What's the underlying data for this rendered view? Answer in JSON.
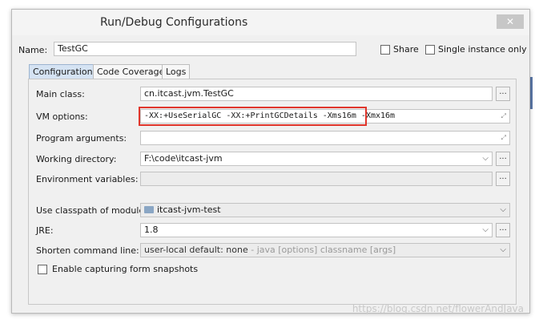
{
  "window": {
    "title": "Run/Debug Configurations",
    "close_glyph": "✕"
  },
  "name_row": {
    "label": "Name:",
    "value": "TestGC",
    "share_label": "Share",
    "single_instance_label": "Single instance only"
  },
  "tabs": [
    {
      "label": "Configuration",
      "active": true
    },
    {
      "label": "Code Coverage",
      "active": false
    },
    {
      "label": "Logs",
      "active": false
    }
  ],
  "form": {
    "main_class": {
      "label": "Main class:",
      "value": "cn.itcast.jvm.TestGC"
    },
    "vm_options": {
      "label": "VM options:",
      "value": "-XX:+UseSerialGC -XX:+PrintGCDetails -Xms16m -Xmx16m"
    },
    "program_arguments": {
      "label": "Program arguments:",
      "value": ""
    },
    "working_directory": {
      "label": "Working directory:",
      "value": "F:\\code\\itcast-jvm"
    },
    "environment_variables": {
      "label": "Environment variables:",
      "value": ""
    },
    "classpath_module": {
      "label": "Use classpath of module:",
      "value": "itcast-jvm-test"
    },
    "jre": {
      "label": "JRE:",
      "value": "1.8"
    },
    "shorten_command_line": {
      "label": "Shorten command line:",
      "value_bold": "user-local default: none",
      "value_hint": " - java [options] classname [args]"
    },
    "capture_snapshots": {
      "label": "Enable capturing form snapshots"
    }
  },
  "icons": {
    "browse": "...",
    "dropdown": "⌵",
    "expand": "⤢"
  },
  "watermark": "https://blog.csdn.net/flowerAndJava",
  "colors": {
    "active_tab": "#d5e3f3",
    "highlight_border": "#e0362c"
  }
}
